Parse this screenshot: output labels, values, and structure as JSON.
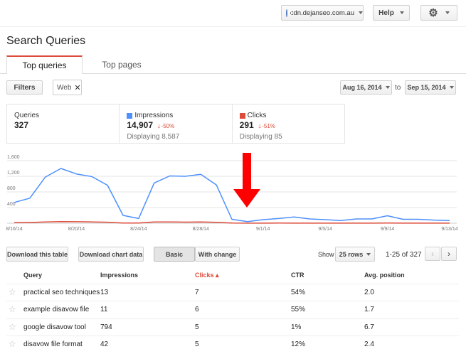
{
  "header": {
    "site": "cdn.dejanseo.com.au",
    "help_label": "Help"
  },
  "page_title": "Search Queries",
  "tabs": [
    {
      "label": "Top queries",
      "active": true
    },
    {
      "label": "Top pages",
      "active": false
    }
  ],
  "filters": {
    "filters_label": "Filters",
    "web_chip": "Web",
    "date_from": "Aug 16, 2014",
    "to_label": "to",
    "date_to": "Sep 15, 2014"
  },
  "summary": {
    "queries": {
      "label": "Queries",
      "value": "327"
    },
    "impressions": {
      "label": "Impressions",
      "value": "14,907",
      "change": "-50%",
      "sub": "Displaying 8,587",
      "color": "#4d90fe"
    },
    "clicks": {
      "label": "Clicks",
      "value": "291",
      "change": "-51%",
      "sub": "Displaying 85",
      "color": "#dd4b39"
    }
  },
  "chart_data": {
    "type": "line",
    "x": [
      "8/16/14",
      "8/17/14",
      "8/18/14",
      "8/19/14",
      "8/20/14",
      "8/21/14",
      "8/22/14",
      "8/23/14",
      "8/24/14",
      "8/25/14",
      "8/26/14",
      "8/27/14",
      "8/28/14",
      "8/29/14",
      "8/30/14",
      "8/31/14",
      "9/1/14",
      "9/2/14",
      "9/3/14",
      "9/4/14",
      "9/5/14",
      "9/6/14",
      "9/7/14",
      "9/8/14",
      "9/9/14",
      "9/10/14",
      "9/11/14",
      "9/12/14",
      "9/13/14"
    ],
    "x_tick_labels": [
      "8/16/14",
      "8/20/14",
      "8/24/14",
      "8/28/14",
      "9/1/14",
      "9/5/14",
      "9/9/14",
      "9/13/14"
    ],
    "y_tick_labels": [
      "1,600",
      "1,200",
      "800",
      "400"
    ],
    "ylim": [
      0,
      1800
    ],
    "grid": true,
    "series": [
      {
        "name": "Impressions",
        "color": "#4d90fe",
        "values": [
          530,
          640,
          1180,
          1400,
          1260,
          1190,
          970,
          200,
          120,
          1030,
          1210,
          1200,
          1250,
          980,
          100,
          40,
          90,
          120,
          160,
          110,
          90,
          70,
          110,
          110,
          190,
          100,
          100,
          80,
          70
        ]
      },
      {
        "name": "Clicks",
        "color": "#dd4b39",
        "values": [
          12,
          18,
          30,
          40,
          38,
          32,
          25,
          5,
          4,
          30,
          32,
          28,
          30,
          22,
          3,
          2,
          2,
          3,
          2,
          2,
          1,
          1,
          2,
          2,
          3,
          2,
          2,
          2,
          1
        ]
      }
    ]
  },
  "toolbar": {
    "download_table": "Download this table",
    "download_chart": "Download chart data",
    "basic": "Basic",
    "with_change": "With change",
    "show_label": "Show",
    "rows_value": "25 rows",
    "pagination": "1-25 of 327"
  },
  "table": {
    "headers": {
      "query": "Query",
      "impressions": "Impressions",
      "clicks": "Clicks ▴",
      "ctr": "CTR",
      "position": "Avg. position"
    },
    "rows": [
      {
        "query": "practical seo techniques",
        "impressions": "13",
        "clicks": "7",
        "ctr": "54%",
        "position": "2.0"
      },
      {
        "query": "example disavow file",
        "impressions": "11",
        "clicks": "6",
        "ctr": "55%",
        "position": "1.7"
      },
      {
        "query": "google disavow tool",
        "impressions": "794",
        "clicks": "5",
        "ctr": "1%",
        "position": "6.7"
      },
      {
        "query": "disavow file format",
        "impressions": "42",
        "clicks": "5",
        "ctr": "12%",
        "position": "2.4"
      }
    ]
  },
  "colors": {
    "accent": "#dd4b39",
    "link": "#4d90fe",
    "arrow": "#ff0000"
  }
}
